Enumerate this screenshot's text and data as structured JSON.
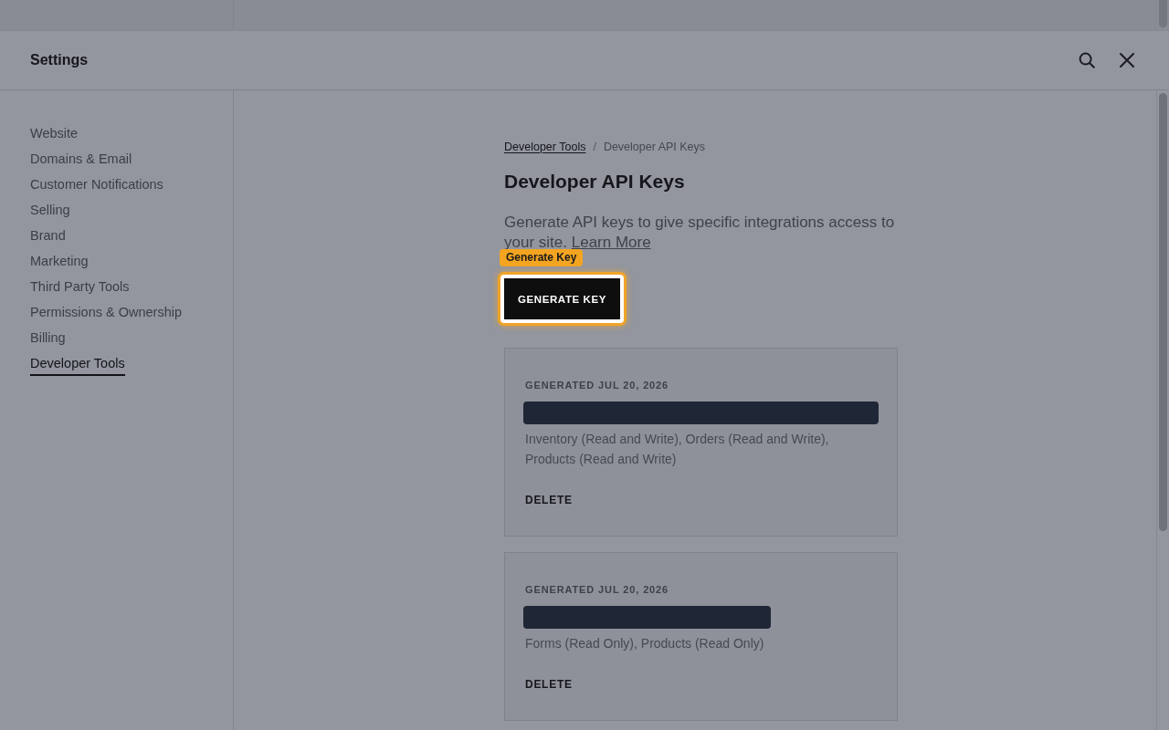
{
  "header": {
    "title": "Settings"
  },
  "sidebar": {
    "items": [
      {
        "label": "Website",
        "selected": false
      },
      {
        "label": "Domains & Email",
        "selected": false
      },
      {
        "label": "Customer Notifications",
        "selected": false
      },
      {
        "label": "Selling",
        "selected": false
      },
      {
        "label": "Brand",
        "selected": false
      },
      {
        "label": "Marketing",
        "selected": false
      },
      {
        "label": "Third Party Tools",
        "selected": false
      },
      {
        "label": "Permissions & Ownership",
        "selected": false
      },
      {
        "label": "Billing",
        "selected": false
      },
      {
        "label": "Developer Tools",
        "selected": true
      }
    ]
  },
  "breadcrumb": {
    "items": [
      {
        "label": "Developer Tools",
        "kind": "link"
      },
      {
        "label": "Developer API Keys",
        "kind": "current"
      }
    ],
    "separator": "/"
  },
  "page": {
    "title": "Developer API Keys",
    "description": "Generate API keys to give specific integrations access to your site.",
    "link": "Learn More"
  },
  "generate_button": {
    "label": "GENERATE KEY",
    "highlighted": true,
    "tooltip": "Generate Key"
  },
  "keys": [
    {
      "generated": "GENERATED JUL 20, 2026",
      "scopes": "Inventory (Read and Write), Orders (Read and Write), Products (Read and Write)",
      "delete": "DELETE"
    },
    {
      "generated": "GENERATED JUL 20, 2026",
      "scopes": "Forms (Read Only), Products (Read Only)",
      "delete": "DELETE"
    }
  ]
}
